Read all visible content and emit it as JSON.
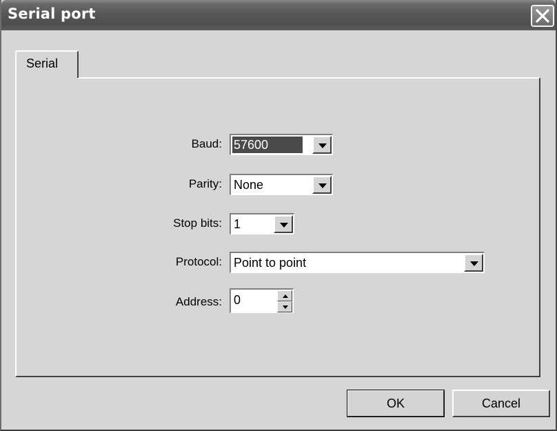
{
  "window": {
    "title": "Serial port"
  },
  "tabs": [
    {
      "label": "Serial"
    }
  ],
  "form": {
    "baud": {
      "label": "Baud:",
      "value": "57600"
    },
    "parity": {
      "label": "Parity:",
      "value": "None"
    },
    "stop_bits": {
      "label": "Stop bits:",
      "value": "1"
    },
    "protocol": {
      "label": "Protocol:",
      "value": "Point to point"
    },
    "address": {
      "label": "Address:",
      "value": "0"
    }
  },
  "buttons": {
    "ok": "OK",
    "cancel": "Cancel"
  },
  "icons": {
    "close": "close-icon",
    "dropdown": "chevron-down-icon",
    "spin_up": "spin-up-icon",
    "spin_down": "spin-down-icon"
  }
}
